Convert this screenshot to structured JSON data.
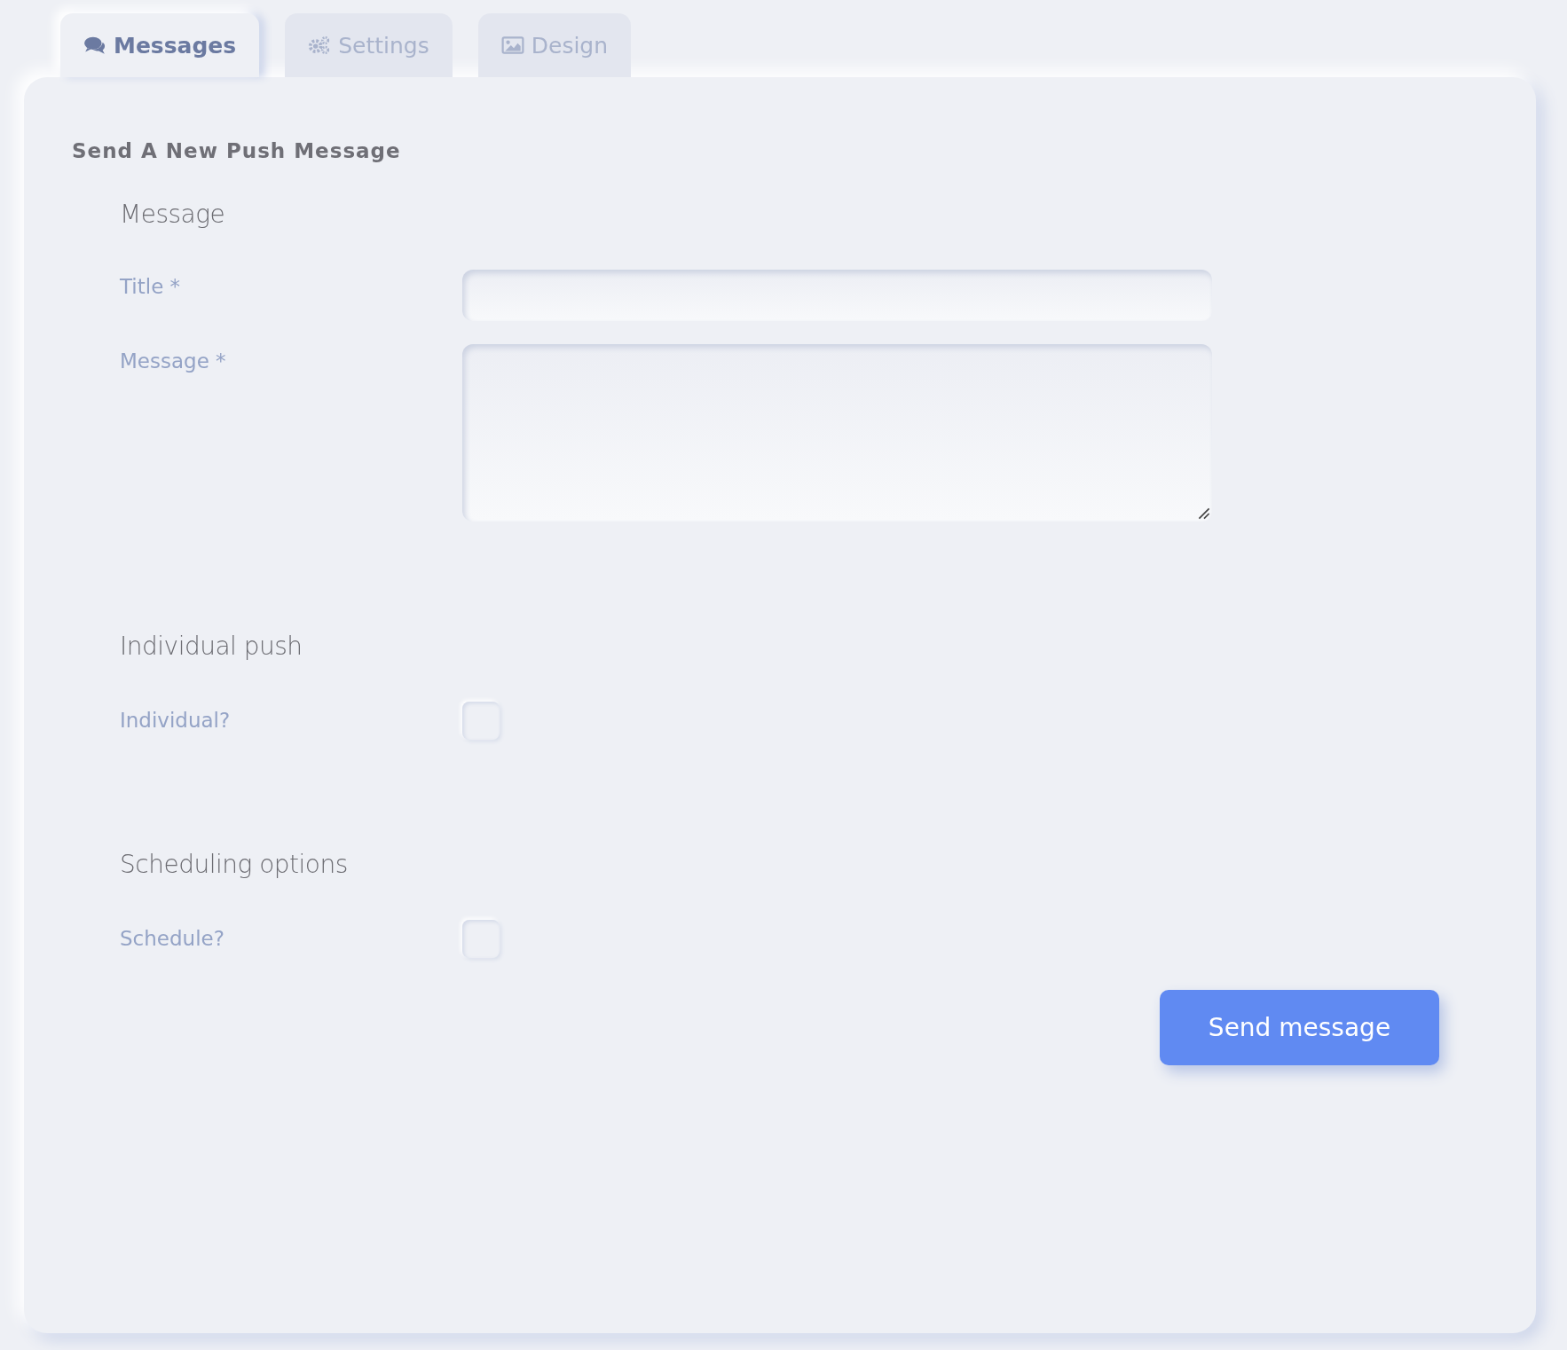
{
  "tabs": [
    {
      "label": "Messages",
      "kind": "chat",
      "selected": true
    },
    {
      "label": "Settings",
      "kind": "gears",
      "selected": false
    },
    {
      "label": "Design",
      "kind": "image",
      "selected": false
    }
  ],
  "panel": {
    "title": "Send A New Push Message",
    "sections": [
      {
        "heading": "Message",
        "fields": [
          {
            "kind": "text",
            "label": "Title *"
          },
          {
            "kind": "textarea",
            "label": "Message *"
          }
        ]
      },
      {
        "heading": "Individual push",
        "fields": [
          {
            "kind": "checkbox",
            "label": "Individual?",
            "checked": false
          }
        ]
      },
      {
        "heading": "Scheduling options",
        "fields": [
          {
            "kind": "checkbox",
            "label": "Schedule?",
            "checked": false
          }
        ]
      }
    ],
    "button": "Send message"
  }
}
